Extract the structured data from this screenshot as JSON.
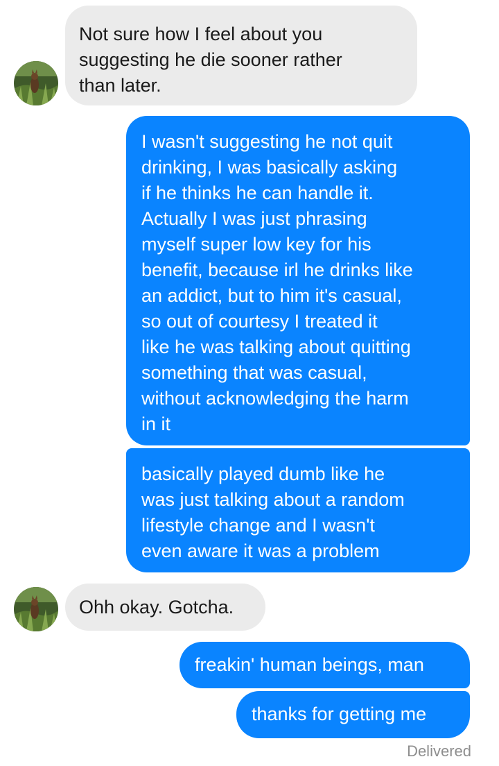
{
  "messages": [
    {
      "sender": "them",
      "text": "Not sure how I feel about you\nsuggesting he die sooner rather\nthan later."
    },
    {
      "sender": "me",
      "text": "I wasn't suggesting he not quit\ndrinking, I was basically asking\nif he thinks he can handle it.\nActually I was just phrasing\nmyself super low key for his\nbenefit, because irl he drinks like\nan addict, but to him it's casual,\nso out of courtesy I treated it\nlike he was talking about quitting\nsomething that was casual,\nwithout acknowledging the harm\nin it"
    },
    {
      "sender": "me",
      "text": "basically played dumb like he\nwas just talking about a random\nlifestyle change and I wasn't\neven aware it was a problem"
    },
    {
      "sender": "them",
      "text": "Ohh okay. Gotcha."
    },
    {
      "sender": "me",
      "text": "freakin' human beings, man"
    },
    {
      "sender": "me",
      "text": "thanks for getting me"
    }
  ],
  "status": "Delivered",
  "colors": {
    "outgoing_bubble": "#0a84ff",
    "incoming_bubble": "#ebebeb",
    "status_text": "#8e8e8e"
  },
  "icons": {
    "contact_avatar": "avatar-photo-icon"
  }
}
